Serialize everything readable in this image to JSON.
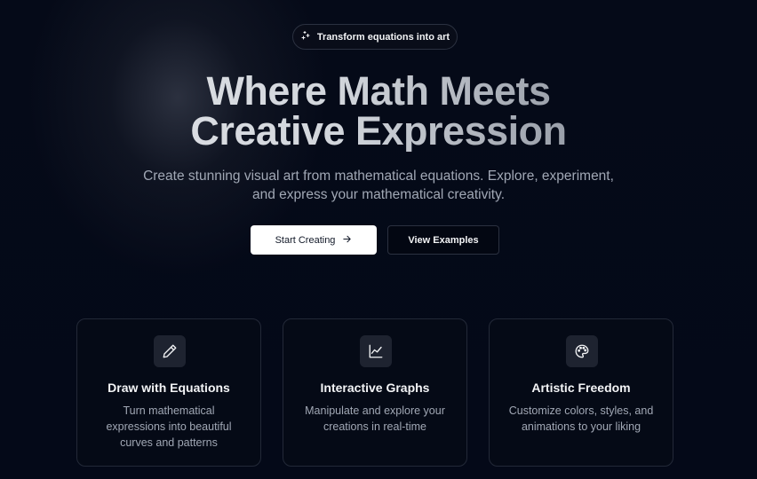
{
  "badge": {
    "label": "Transform equations into art",
    "icon": "sparkles-icon"
  },
  "hero": {
    "title_line1": "Where Math Meets",
    "title_line2": "Creative Expression",
    "subtitle_line1": "Create stunning visual art from mathematical equations. Explore, experiment,",
    "subtitle_line2": "and express your mathematical creativity."
  },
  "buttons": {
    "primary": {
      "label": "Start Creating",
      "icon": "arrow-right-icon"
    },
    "secondary": {
      "label": "View Examples"
    }
  },
  "features": [
    {
      "icon": "pencil-icon",
      "title": "Draw with Equations",
      "desc_lines": [
        "Turn mathematical",
        "expressions into beautiful",
        "curves and patterns"
      ]
    },
    {
      "icon": "chart-line-icon",
      "title": "Interactive Graphs",
      "desc_lines": [
        "Manipulate and explore your",
        "creations in real-time"
      ]
    },
    {
      "icon": "palette-icon",
      "title": "Artistic Freedom",
      "desc_lines": [
        "Customize colors, styles, and",
        "animations to your liking"
      ]
    }
  ],
  "colors": {
    "background": "#030712",
    "card_border": "#232938",
    "primary_button_bg": "#ffffff",
    "muted_text": "#a1a8b5"
  }
}
